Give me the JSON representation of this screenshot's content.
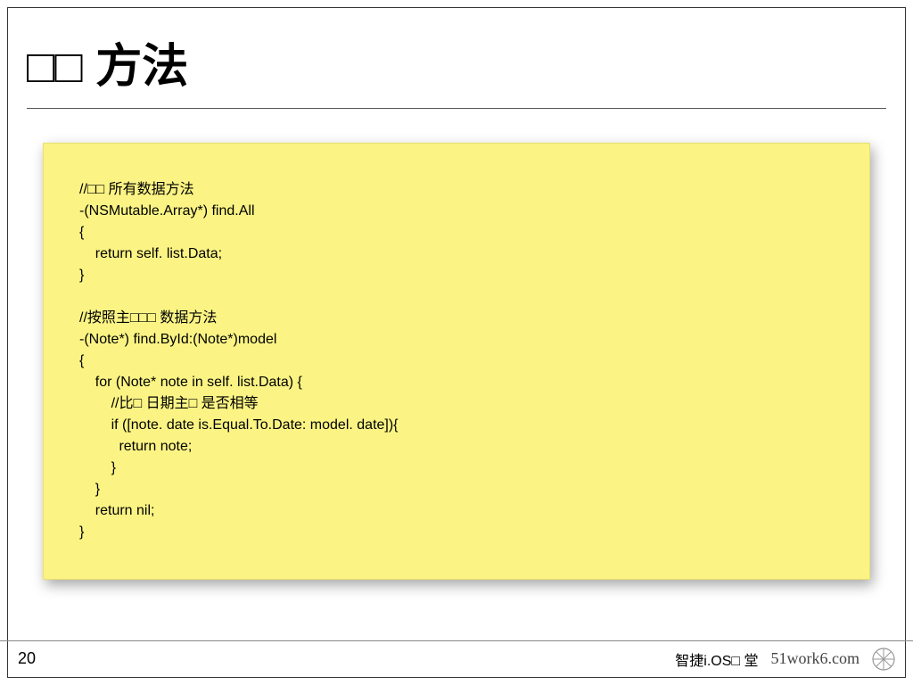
{
  "title": "□□ 方法",
  "code": "//□□ 所有数据方法\n-(NSMutable.Array*) find.All\n{\n    return self. list.Data;\n}\n\n//按照主□□□ 数据方法\n-(Note*) find.ById:(Note*)model\n{\n    for (Note* note in self. list.Data) {\n        //比□ 日期主□ 是否相等\n        if ([note. date is.Equal.To.Date: model. date]){\n          return note;\n        }\n    }\n    return nil;\n}",
  "footer": {
    "page": "20",
    "brand": "智捷i.OS□ 堂",
    "site": "51work6.com"
  }
}
